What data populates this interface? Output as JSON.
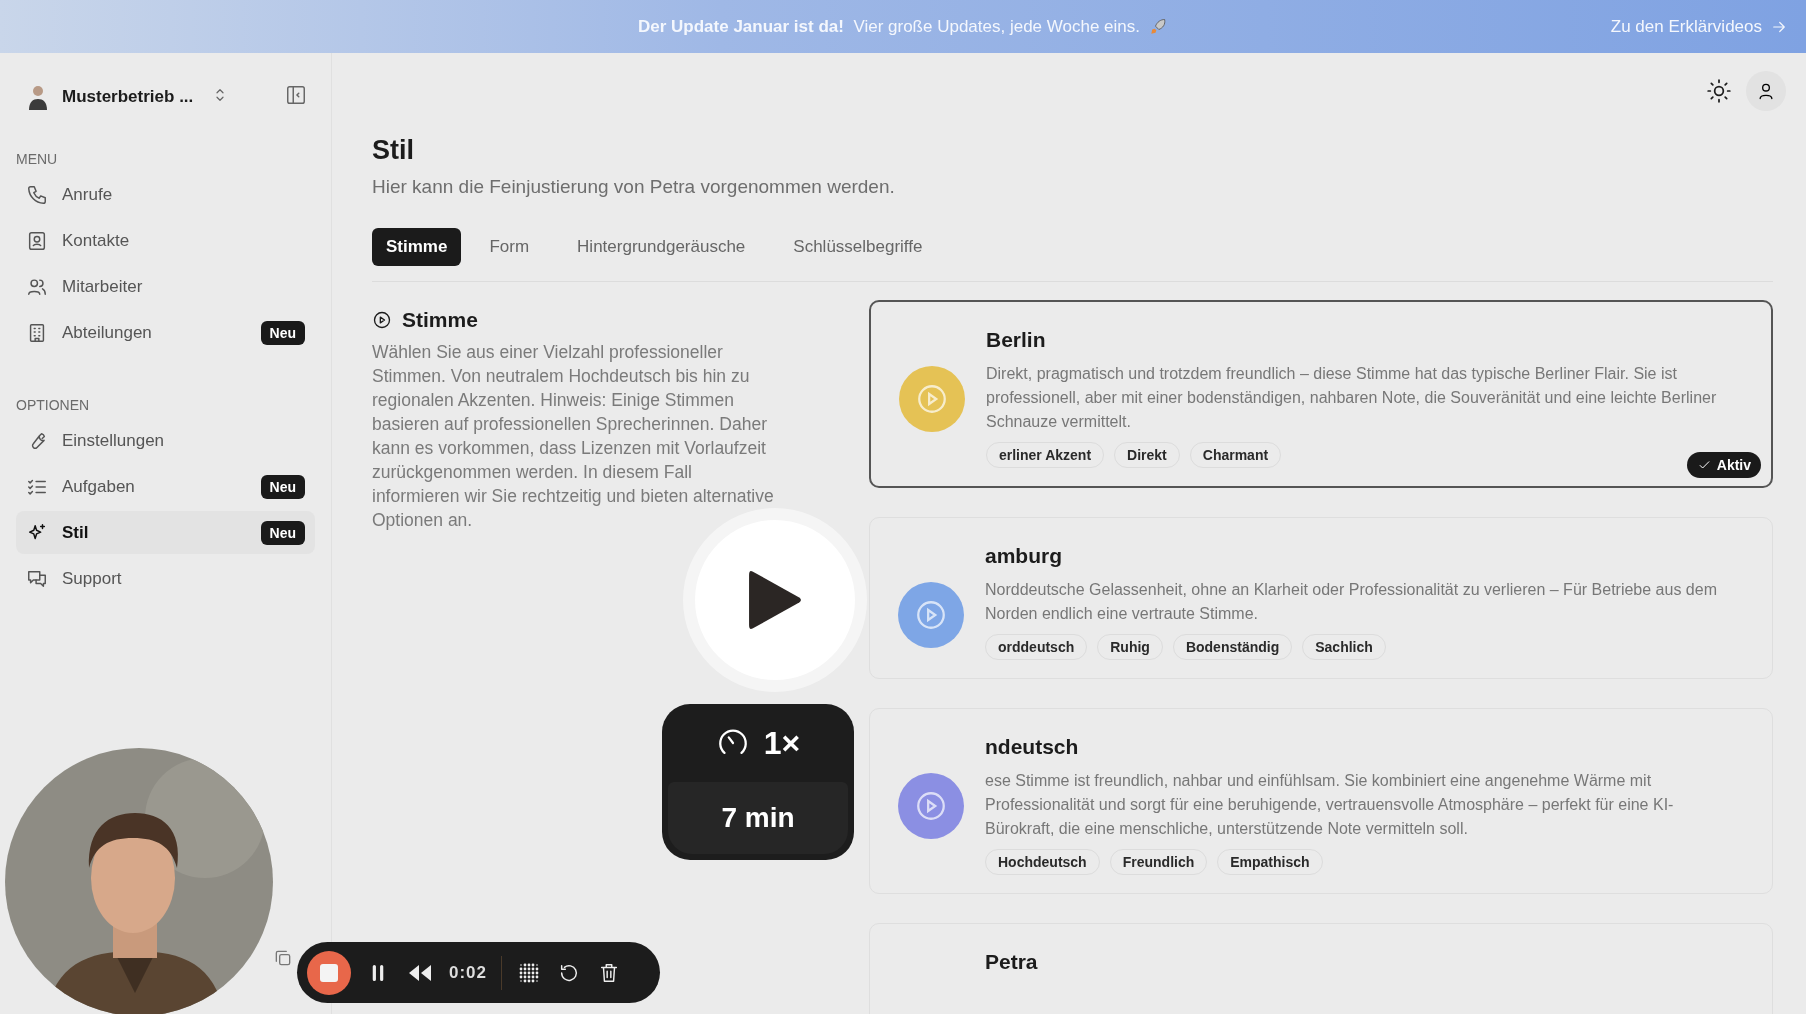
{
  "banner": {
    "headline": "Der Update Januar ist da!",
    "text": "Vier große Updates, jede Woche eins.",
    "link": "Zu den Erklärvideos"
  },
  "sidebar": {
    "account": "Musterbetrieb ...",
    "sections": [
      {
        "label": "MENU",
        "items": [
          {
            "label": "Anrufe",
            "selected": false
          },
          {
            "label": "Kontakte",
            "selected": false
          },
          {
            "label": "Mitarbeiter",
            "selected": false
          },
          {
            "label": "Abteilungen",
            "selected": false,
            "badge": "Neu"
          }
        ]
      },
      {
        "label": "OPTIONEN",
        "items": [
          {
            "label": "Einstellungen",
            "selected": false
          },
          {
            "label": "Aufgaben",
            "selected": false,
            "badge": "Neu"
          },
          {
            "label": "Stil",
            "selected": true,
            "badge": "Neu"
          },
          {
            "label": "Support",
            "selected": false
          }
        ]
      }
    ]
  },
  "page": {
    "title": "Stil",
    "subtitle": "Hier kann die Feinjustierung von Petra vorgenommen werden."
  },
  "tabs": [
    {
      "label": "Stimme",
      "selected": true
    },
    {
      "label": "Form",
      "selected": false
    },
    {
      "label": "Hintergrundgeräusche",
      "selected": false
    },
    {
      "label": "Schlüsselbegriffe",
      "selected": false
    }
  ],
  "section": {
    "title": "Stimme",
    "description": "Wählen Sie aus einer Vielzahl professioneller Stimmen. Von neutralem Hochdeutsch bis hin zu regionalen Akzenten. Hinweis: Einige Stimmen basieren auf professionellen Sprecherinnen. Daher kann es vorkommen, dass Lizenzen mit Vorlaufzeit zurückgenommen werden. In diesem Fall informieren wir Sie rechtzeitig und bieten alternative Optionen an."
  },
  "voices": [
    {
      "title": "Berlin",
      "description": "Direkt, pragmatisch und trotzdem freundlich – diese Stimme hat das typische Berliner Flair. Sie ist professionell, aber mit einer bodenständigen, nahbaren Note, die Souveränität und eine leichte Berliner Schnauze vermittelt.",
      "tags": [
        "erliner Akzent",
        "Direkt",
        "Charmant"
      ],
      "color": "#e5c255",
      "selected": true,
      "badge": "Aktiv"
    },
    {
      "title": "amburg",
      "description": "Norddeutsche Gelassenheit, ohne an Klarheit oder Professionalität zu verlieren – Für Betriebe aus dem Norden endlich eine vertraute Stimme.",
      "tags": [
        "orddeutsch",
        "Ruhig",
        "Bodenständig",
        "Sachlich"
      ],
      "color": "#7ea6e6",
      "selected": false
    },
    {
      "title": "ndeutsch",
      "description": "ese Stimme ist freundlich, nahbar und einfühlsam. Sie kombiniert eine angenehme Wärme mit Professionalität und sorgt für eine beruhigende, vertrauensvolle Atmosphäre – perfekt für eine KI-Bürokraft, die eine menschliche, unterstützende Note vermitteln soll.",
      "tags": [
        "Hochdeutsch",
        "Freundlich",
        "Empathisch"
      ],
      "color": "#8b8fe3",
      "selected": false
    },
    {
      "title": "Petra",
      "selected": false
    }
  ],
  "player": {
    "speed": "1×",
    "duration": "7 min"
  },
  "recorder": {
    "time": "0:02"
  }
}
